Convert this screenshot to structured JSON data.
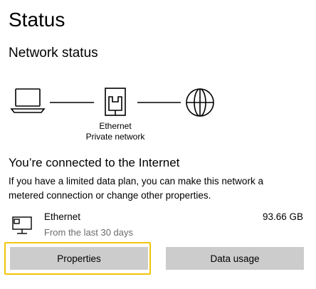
{
  "page": {
    "title": "Status"
  },
  "network_status": {
    "heading": "Network status",
    "adapter_name": "Ethernet",
    "network_profile": "Private network"
  },
  "connection": {
    "heading": "You’re connected to the Internet",
    "description": "If you have a limited data plan, you can make this network a metered connection or change other properties."
  },
  "adapter_row": {
    "name": "Ethernet",
    "period": "From the last 30 days",
    "usage": "93.66 GB"
  },
  "buttons": {
    "properties_label": "Properties",
    "data_usage_label": "Data usage"
  },
  "icons": {
    "computer": "laptop-icon",
    "adapter": "ethernet-port-icon",
    "internet": "globe-icon",
    "row": "ethernet-computer-icon"
  },
  "colors": {
    "focus_ring": "#f2c40c",
    "button_bg": "#cccccc",
    "secondary_text": "#6b6b6b"
  }
}
